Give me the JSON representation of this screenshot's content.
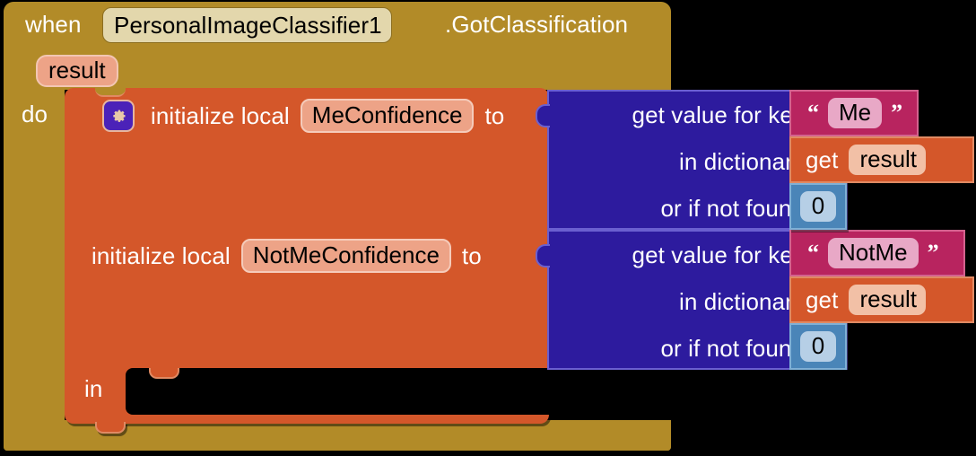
{
  "event": {
    "when_label": "when",
    "component_name": "PersonalImageClassifier1",
    "method_label": ".GotClassification",
    "parameter": "result",
    "do_label": "do",
    "dropdown_icon": "chevron-down-icon",
    "color": "#b28b28"
  },
  "local": {
    "mutator_icon": "gear-icon",
    "init_label": "initialize local",
    "to_label": "to",
    "in_label": "in",
    "variables": [
      {
        "name": "MeConfidence"
      },
      {
        "name": "NotMeConfidence"
      }
    ],
    "color": "#d4572a"
  },
  "dictionaries": [
    {
      "key_label": "get value for key",
      "dict_label": "in dictionary",
      "notfound_label": "or if not found",
      "key_value": "Me",
      "dict_variable": "result",
      "dict_get_label": "get",
      "notfound_value": "0",
      "open_quote": "“",
      "close_quote": "”"
    },
    {
      "key_label": "get value for key",
      "dict_label": "in dictionary",
      "notfound_label": "or if not found",
      "key_value": "NotMe",
      "dict_variable": "result",
      "dict_get_label": "get",
      "notfound_value": "0",
      "open_quote": "“",
      "close_quote": "”"
    }
  ],
  "colors": {
    "event_block": "#b28b28",
    "local_block": "#d4572a",
    "dictionary_block": "#2d1b9e",
    "text_block": "#b8245f",
    "number_block": "#4a85b8",
    "mutator": "#4b22b8",
    "canvas": "#000000"
  }
}
